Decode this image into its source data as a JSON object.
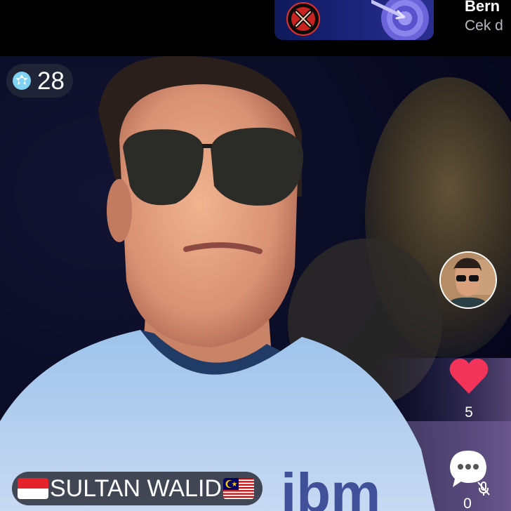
{
  "banner": {
    "title": "Bern",
    "subtitle": "Cek d"
  },
  "viewers": {
    "count": "28",
    "icon": "diamond-badge-icon"
  },
  "host": {
    "name": "SULTAN WALID",
    "flag_left": "indonesia-flag-icon",
    "flag_right": "malaysia-flag-icon"
  },
  "actions": {
    "likes": "5",
    "comments": "0"
  },
  "colors": {
    "like": "#f2335a",
    "banner_bg": "#1a2377",
    "viewer_badge": "#7fd3f2"
  }
}
